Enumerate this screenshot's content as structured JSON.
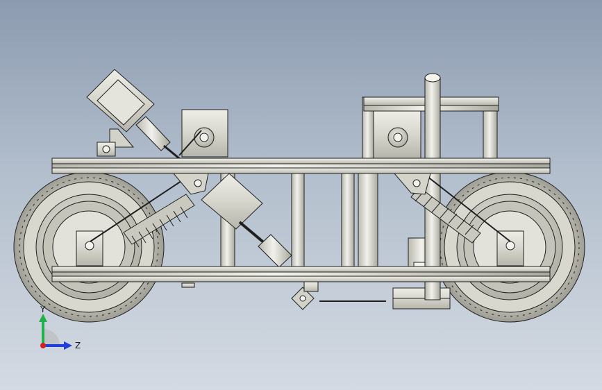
{
  "viewport": {
    "background_top": "#8c9bb0",
    "background_bottom": "#d4dae3"
  },
  "model": {
    "part_color": "#dcdcd3",
    "edge_color": "#1f1f1f",
    "shade_color": "#b9b9b0"
  },
  "triad": {
    "y_label": "Y",
    "z_label": "Z",
    "y_color": "#23b04a",
    "z_color": "#1f3fd8",
    "x_color": "#d42020"
  }
}
